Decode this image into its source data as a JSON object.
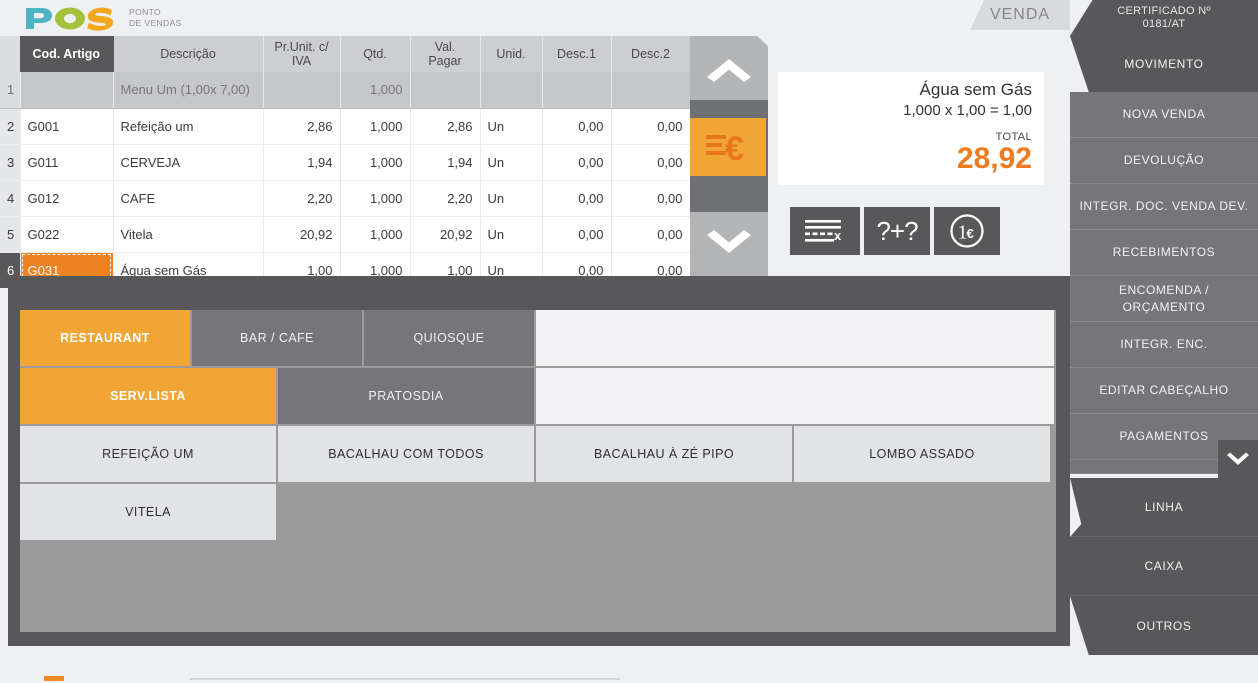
{
  "brand": {
    "logo_letters": [
      "P",
      "O",
      "S"
    ],
    "logo_colors": {
      "p": "#4eb3c4",
      "o": "#a3c23c",
      "s": "#f3a81c"
    },
    "subtitle_line1": "PONTO",
    "subtitle_line2": "DE VENDAS"
  },
  "items_table": {
    "headers": [
      "",
      "Cod. Artigo",
      "Descrição",
      "Pr.Unit. c/ IVA",
      "Qtd.",
      "Val. Pagar",
      "Unid.",
      "Desc.1",
      "Desc.2"
    ],
    "header_parts": {
      "rownum": "",
      "cod": "Cod. Artigo",
      "desc": "Descrição",
      "price_l1": "Pr.Unit. c/",
      "price_l2": "IVA",
      "qty": "Qtd.",
      "val_l1": "Val.",
      "val_l2": "Pagar",
      "unid": "Unid.",
      "desc1": "Desc.1",
      "desc2": "Desc.2"
    },
    "rows": [
      {
        "n": "1",
        "cod": "",
        "desc": "Menu Um  (1,00x 7,00)",
        "price": "",
        "qty": "1,000",
        "val": "",
        "unid": "",
        "d1": "",
        "d2": "",
        "style": "menu"
      },
      {
        "n": "2",
        "cod": "G001",
        "desc": "Refeição um",
        "price": "2,86",
        "qty": "1,000",
        "val": "2,86",
        "unid": "Un",
        "d1": "0,00",
        "d2": "0,00",
        "style": "orange"
      },
      {
        "n": "3",
        "cod": "G011",
        "desc": "CERVEJA",
        "price": "1,94",
        "qty": "1,000",
        "val": "1,94",
        "unid": "Un",
        "d1": "0,00",
        "d2": "0,00",
        "style": "orange"
      },
      {
        "n": "4",
        "cod": "G012",
        "desc": "CAFE",
        "price": "2,20",
        "qty": "1,000",
        "val": "2,20",
        "unid": "Un",
        "d1": "0,00",
        "d2": "0,00",
        "style": "orange"
      },
      {
        "n": "5",
        "cod": "G022",
        "desc": "Vitela",
        "price": "20,92",
        "qty": "1,000",
        "val": "20,92",
        "unid": "Un",
        "d1": "0,00",
        "d2": "0,00",
        "style": "normal"
      },
      {
        "n": "6",
        "cod": "G031",
        "desc": "Água sem Gás",
        "price": "1,00",
        "qty": "1,000",
        "val": "1,00",
        "unid": "Un",
        "d1": "0,00",
        "d2": "0,00",
        "style": "selected"
      }
    ]
  },
  "display": {
    "item_name": "Água sem Gás",
    "calculation": "1,000 x 1,00 = 1,00",
    "total_label": "TOTAL",
    "total_value": "28,92",
    "total_color": "#ee7b22"
  },
  "action_buttons": [
    {
      "name": "delete-line-icon",
      "label": ""
    },
    {
      "name": "sum-question-icon",
      "label": "?+?"
    },
    {
      "name": "one-euro-icon",
      "label": ""
    }
  ],
  "scroll_strip": {
    "up_icon": "chevron-up-icon",
    "down_icon": "chevron-down-icon",
    "euro_icon": "euro-lines-icon"
  },
  "sidebar": {
    "tab_label": "VENDA",
    "certificate_line1": "CERTIFICADO Nº",
    "certificate_line2": "0181/AT",
    "active_item": "MOVIMENTO",
    "items": [
      {
        "label": "NOVA VENDA"
      },
      {
        "label": "DEVOLUÇÃO"
      },
      {
        "label": "INTEGR. DOC. VENDA DEV."
      },
      {
        "label": "RECEBIMENTOS"
      },
      {
        "label": "ENCOMENDA / ORÇAMENTO"
      },
      {
        "label": "INTEGR. ENC."
      },
      {
        "label": "EDITAR CABEÇALHO"
      },
      {
        "label": "PAGAMENTOS"
      }
    ],
    "scroll_down_icon": "chevron-down-icon",
    "bottom_items": [
      {
        "label": "LINHA"
      },
      {
        "label": "CAIXA"
      },
      {
        "label": "OUTROS"
      }
    ]
  },
  "product_panel": {
    "categories": [
      {
        "label": "RESTAURANT",
        "active": true
      },
      {
        "label": "BAR / CAFE",
        "active": false
      },
      {
        "label": "QUIOSQUE",
        "active": false
      }
    ],
    "subcategories": [
      {
        "label": "SERV.LISTA",
        "active": true
      },
      {
        "label": "PRATOSDIA",
        "active": false
      }
    ],
    "products": [
      {
        "label": "REFEIÇÃO UM"
      },
      {
        "label": "BACALHAU COM TODOS"
      },
      {
        "label": "BACALHAU À ZÉ PIPO"
      },
      {
        "label": "LOMBO ASSADO"
      },
      {
        "label": "VITELA"
      }
    ]
  }
}
